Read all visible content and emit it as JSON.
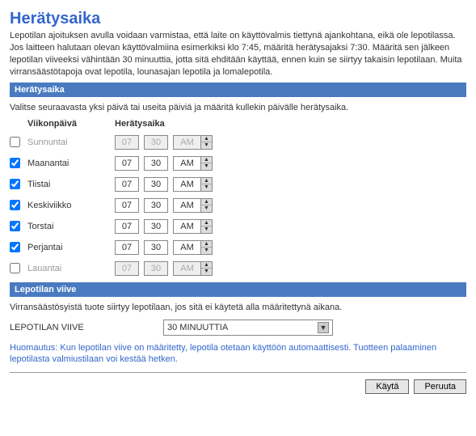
{
  "title": "Herätysaika",
  "intro": "Lepotilan ajoituksen avulla voidaan varmistaa, että laite on käyttövalmis tiettynä ajankohtana, eikä ole lepotilassa. Jos laitteen halutaan olevan käyttövalmiina esimerkiksi klo 7:45, määritä herätysajaksi 7:30. Määritä sen jälkeen lepotilan viiveeksi vähintään 30 minuuttia, jotta sitä ehditään käyttää, ennen kuin se siirtyy takaisin lepotilaan. Muita virransäästötapoja ovat lepotila, lounasajan lepotila ja lomalepotila.",
  "sections": {
    "wake": {
      "bar": "Herätysaika",
      "sub": "Valitse seuraavasta yksi päivä tai useita päiviä ja määritä kullekin päivälle herätysaika.",
      "col_day": "Viikonpäivä",
      "col_time": "Herätysaika"
    },
    "delay": {
      "bar": "Lepotilan viive",
      "sub": "Virransäästösyistä tuote siirtyy lepotilaan, jos sitä ei käytetä alla määritettynä aikana.",
      "label": "LEPOTILAN VIIVE",
      "selected": "30 MINUUTTIA"
    }
  },
  "days": [
    {
      "name": "Sunnuntai",
      "checked": false,
      "hh": "07",
      "mm": "30",
      "ampm": "AM"
    },
    {
      "name": "Maanantai",
      "checked": true,
      "hh": "07",
      "mm": "30",
      "ampm": "AM"
    },
    {
      "name": "Tiistai",
      "checked": true,
      "hh": "07",
      "mm": "30",
      "ampm": "AM"
    },
    {
      "name": "Keskiviikko",
      "checked": true,
      "hh": "07",
      "mm": "30",
      "ampm": "AM"
    },
    {
      "name": "Torstai",
      "checked": true,
      "hh": "07",
      "mm": "30",
      "ampm": "AM"
    },
    {
      "name": "Perjantai",
      "checked": true,
      "hh": "07",
      "mm": "30",
      "ampm": "AM"
    },
    {
      "name": "Lauantai",
      "checked": false,
      "hh": "07",
      "mm": "30",
      "ampm": "AM"
    }
  ],
  "note": "Huomautus: Kun lepotilan viive on määritetty, lepotila otetaan käyttöön automaattisesti. Tuotteen palaaminen lepotilasta valmiustilaan voi kestää hetken.",
  "buttons": {
    "apply": "Käytä",
    "cancel": "Peruuta"
  }
}
